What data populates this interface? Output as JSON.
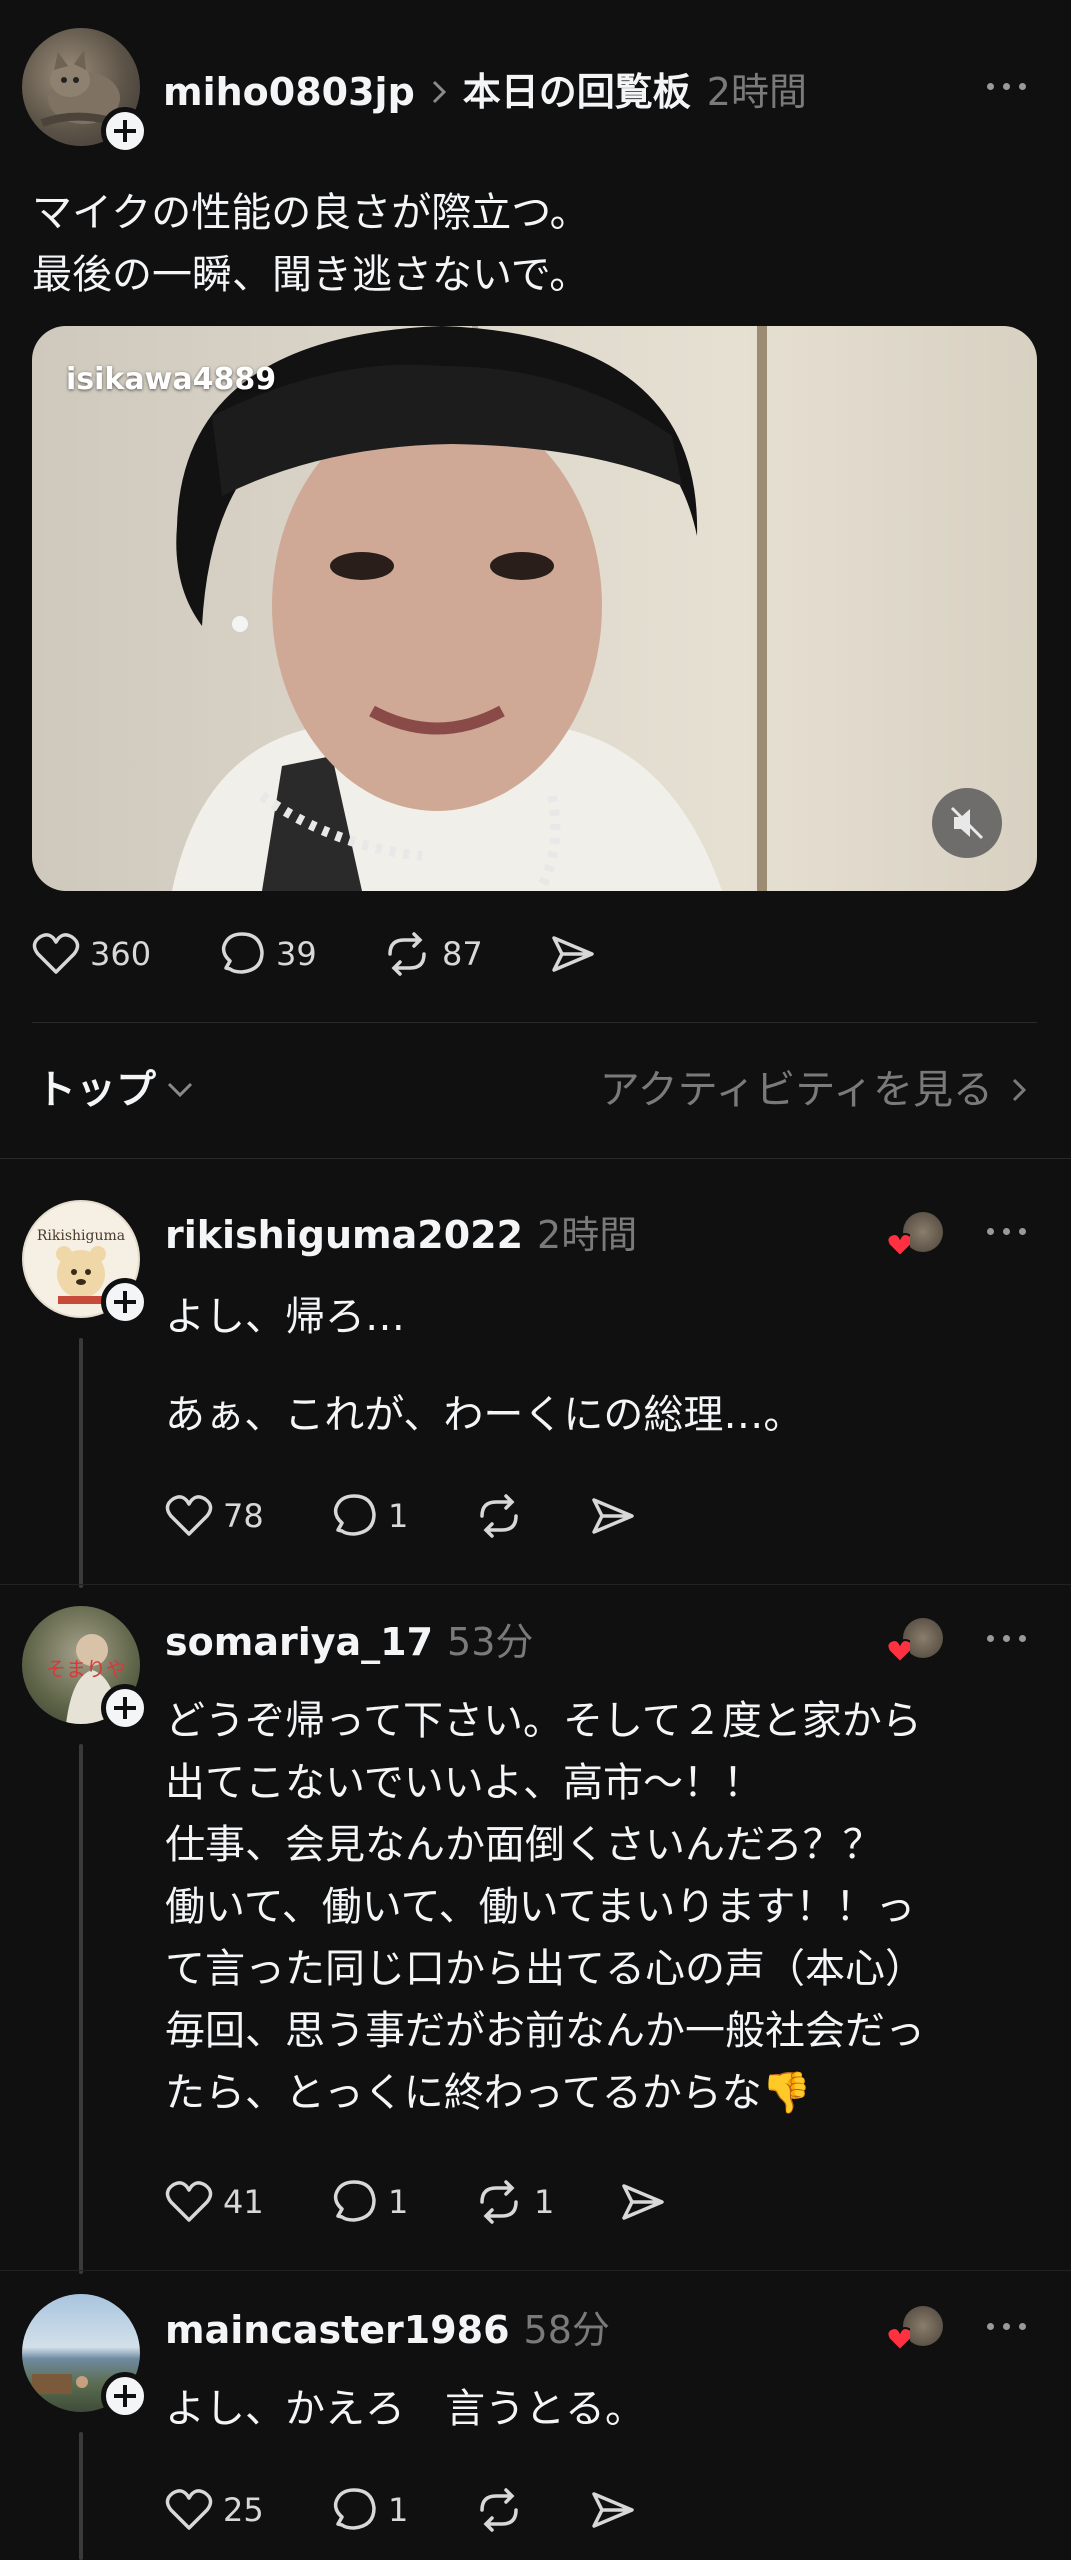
{
  "post": {
    "username": "miho0803jp",
    "community": "本日の回覧板",
    "time": "2時間",
    "lines": [
      "マイクの性能の良さが際立つ。",
      "最後の一瞬、聞き逃さないで。"
    ],
    "video_overlay": "isikawa4889",
    "likes": "360",
    "replies": "39",
    "reposts": "87"
  },
  "sort_bar": {
    "sort_label": "トップ",
    "activity_label": "アクティビティを見る"
  },
  "replies": [
    {
      "username": "rikishiguma2022",
      "time": "2時間",
      "avatar_text": "Rikishiguma",
      "lines": [
        "よし、帰ろ…",
        "",
        "あぁ、これが、わーくにの総理…。"
      ],
      "likes": "78",
      "replies": "1",
      "reposts": ""
    },
    {
      "username": "somariya_17",
      "time": "53分",
      "avatar_text": "そまりや",
      "lines": [
        "どうぞ帰って下さい。そして２度と家から",
        "出てこないでいいよ、高市〜！！",
        "仕事、会見なんか面倒くさいんだろ？？",
        "働いて、働いて、働いてまいります！！っ",
        "て言った同じ口から出てる心の声（本心）",
        "毎回、思う事だがお前なんか一般社会だっ",
        "たら、とっくに終わってるからな👎"
      ],
      "likes": "41",
      "replies": "1",
      "reposts": "1"
    },
    {
      "username": "maincaster1986",
      "time": "58分",
      "lines": [
        "よし、かえろ　言うとる。"
      ],
      "likes": "25",
      "replies": "1",
      "reposts": ""
    }
  ],
  "colors": {
    "background": "#101010",
    "text": "#f3f5f7",
    "muted": "#7a7a7a",
    "heart_red": "#ff3040"
  }
}
